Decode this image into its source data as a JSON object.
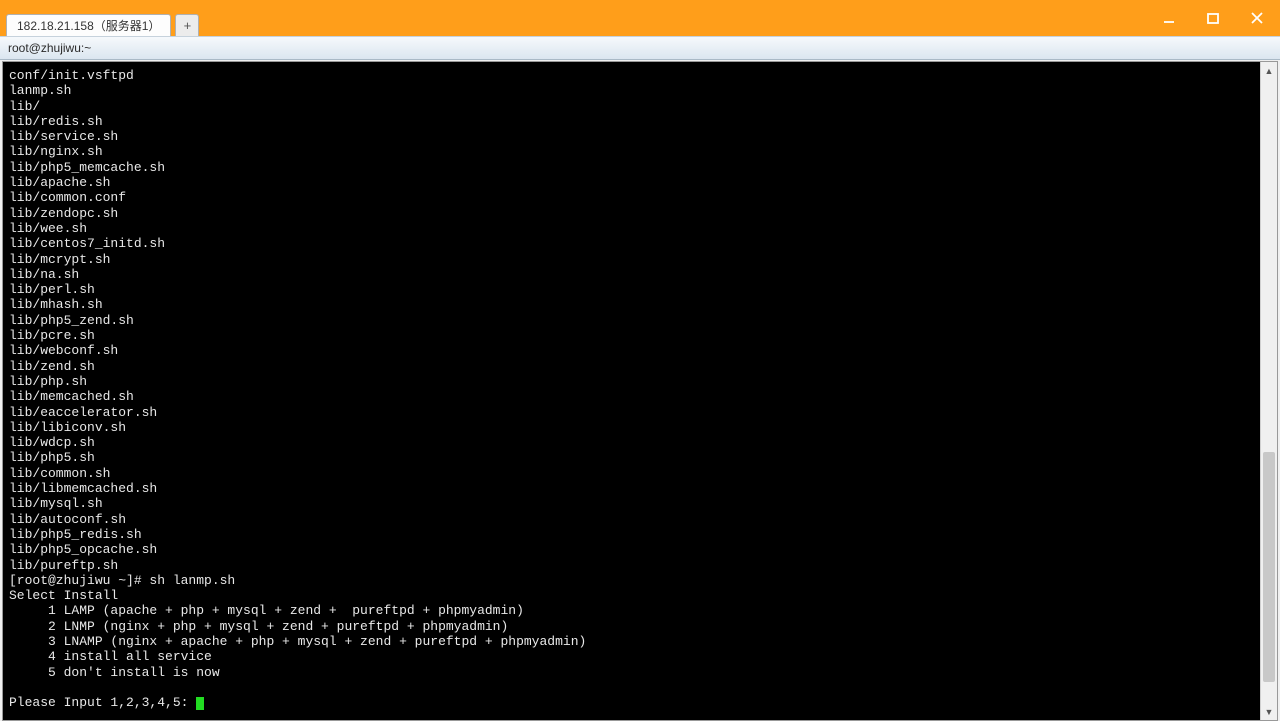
{
  "header": {
    "tab_label": "182.18.21.158（服务器1）",
    "plus_label": "+"
  },
  "breadcrumb": "root@zhujiwu:~",
  "terminal": {
    "lines": [
      "conf/init.vsftpd",
      "lanmp.sh",
      "lib/",
      "lib/redis.sh",
      "lib/service.sh",
      "lib/nginx.sh",
      "lib/php5_memcache.sh",
      "lib/apache.sh",
      "lib/common.conf",
      "lib/zendopc.sh",
      "lib/wee.sh",
      "lib/centos7_initd.sh",
      "lib/mcrypt.sh",
      "lib/na.sh",
      "lib/perl.sh",
      "lib/mhash.sh",
      "lib/php5_zend.sh",
      "lib/pcre.sh",
      "lib/webconf.sh",
      "lib/zend.sh",
      "lib/php.sh",
      "lib/memcached.sh",
      "lib/eaccelerator.sh",
      "lib/libiconv.sh",
      "lib/wdcp.sh",
      "lib/php5.sh",
      "lib/common.sh",
      "lib/libmemcached.sh",
      "lib/mysql.sh",
      "lib/autoconf.sh",
      "lib/php5_redis.sh",
      "lib/php5_opcache.sh",
      "lib/pureftp.sh",
      "[root@zhujiwu ~]# sh lanmp.sh",
      "Select Install",
      "     1 LAMP (apache + php + mysql + zend +  pureftpd + phpmyadmin)",
      "     2 LNMP (nginx + php + mysql + zend + pureftpd + phpmyadmin)",
      "     3 LNAMP (nginx + apache + php + mysql + zend + pureftpd + phpmyadmin)",
      "     4 install all service",
      "     5 don't install is now",
      ""
    ],
    "prompt": "Please Input 1,2,3,4,5: "
  }
}
